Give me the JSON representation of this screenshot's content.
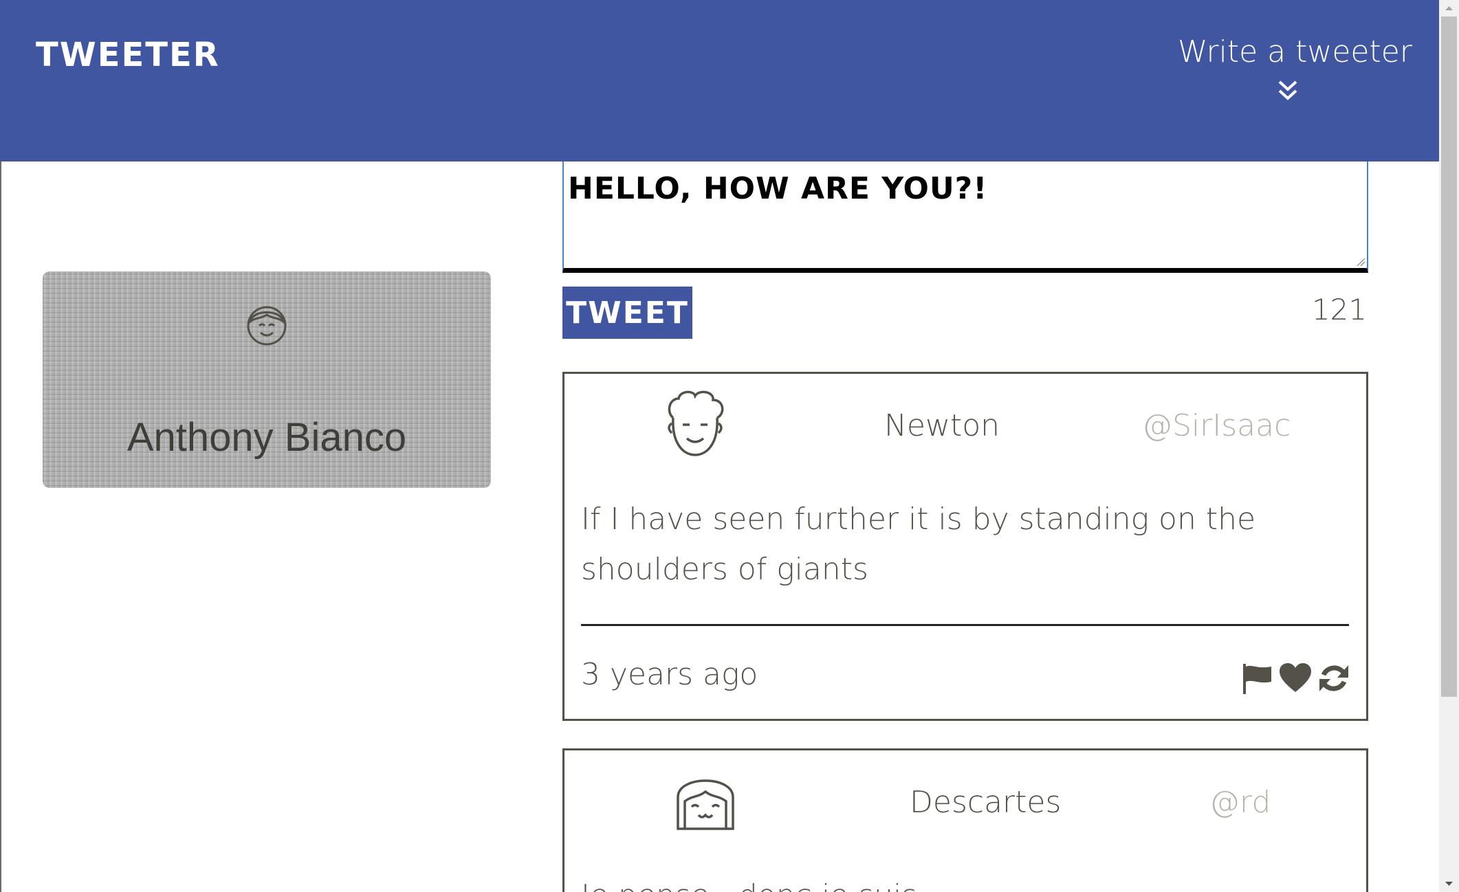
{
  "header": {
    "brand": "Tweeter",
    "compose_toggle_label": "Write a tweeter",
    "background_color": "#4056a1"
  },
  "profile": {
    "name": "Anthony Bianco",
    "avatar_icon": "smiling-face-avatar-icon"
  },
  "composer": {
    "value": "Hello, how are you?!",
    "submit_label": "Tweet",
    "char_counter": "121"
  },
  "tweets": [
    {
      "avatar_icon": "curly-hair-avatar-icon",
      "name": "Newton",
      "handle": "@SirIsaac",
      "content": "If I have seen further it is by standing on the shoulders of giants",
      "timestamp": "3 years ago",
      "actions": [
        "flag-icon",
        "heart-icon",
        "retweet-icon"
      ]
    },
    {
      "avatar_icon": "bob-hair-avatar-icon",
      "name": "Descartes",
      "handle": "@rd",
      "content": "Je pense , donc je suis"
    }
  ]
}
